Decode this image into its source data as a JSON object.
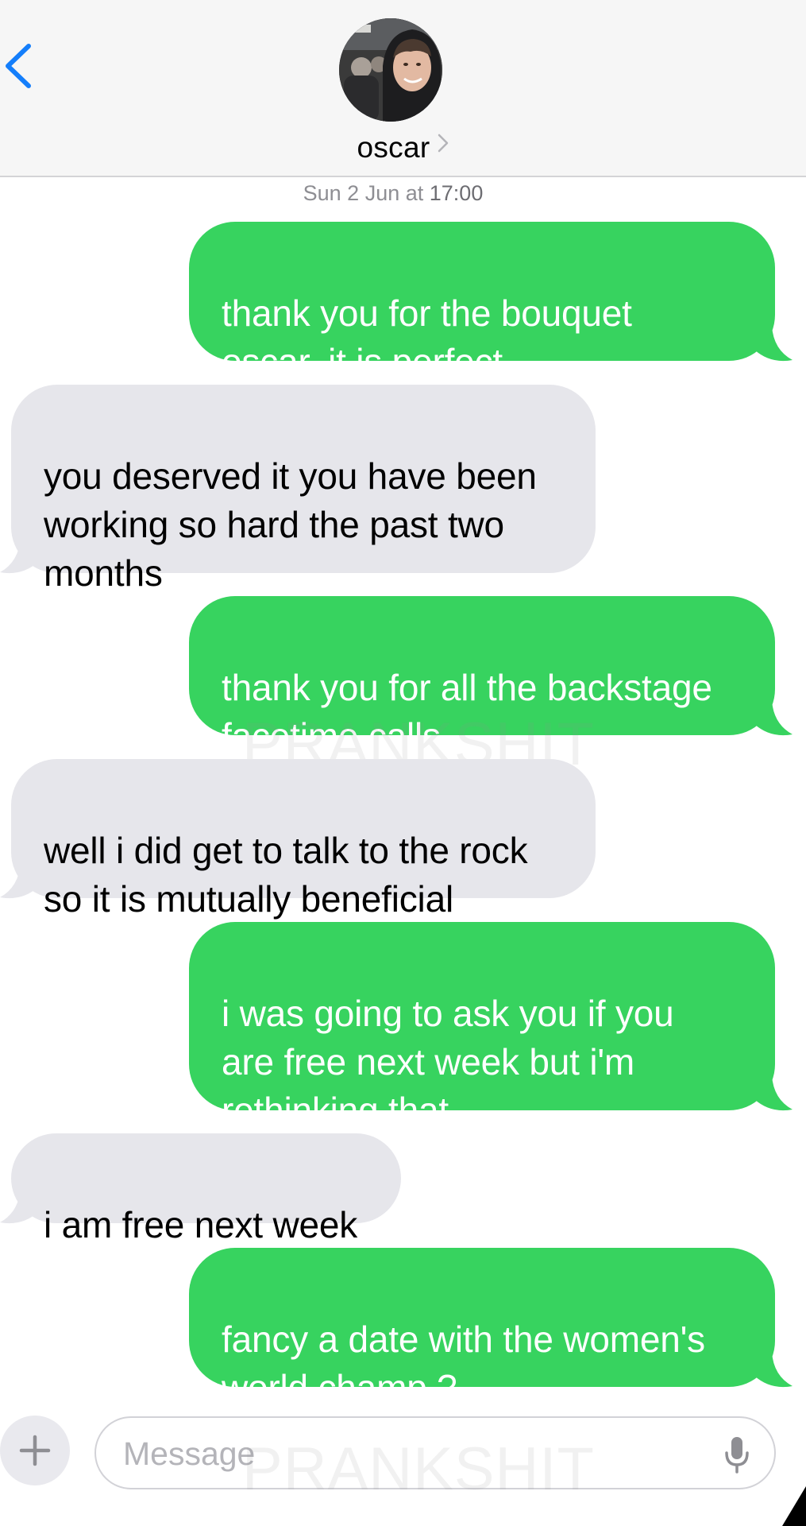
{
  "header": {
    "contact_name": "oscar",
    "back_icon": "chevron-left-icon",
    "details_icon": "chevron-right-icon"
  },
  "thread": {
    "timestamp_day": "Sun 2 Jun at ",
    "timestamp_time": "17:00"
  },
  "messages": [
    {
      "direction": "sent",
      "text": "thank you for the bouquet\noscar, it is perfect"
    },
    {
      "direction": "received",
      "text": "you deserved it you have been\nworking so hard the past two\nmonths"
    },
    {
      "direction": "sent",
      "text": "thank you for all the backstage\nfacetime calls"
    },
    {
      "direction": "received",
      "text": "well i did get to talk to the rock\nso it is mutually beneficial"
    },
    {
      "direction": "sent",
      "text": "i was going to ask you if you\nare free next week but i'm\nrethinking that"
    },
    {
      "direction": "received",
      "text": "i am free next week"
    },
    {
      "direction": "sent",
      "text": "fancy a date with the women's\nworld champ ?"
    }
  ],
  "watermark": "PRANKSHIT",
  "composer": {
    "placeholder": "Message",
    "plus_icon": "plus-icon",
    "mic_icon": "microphone-icon"
  },
  "colors": {
    "sent_bubble": "#37d35f",
    "received_bubble": "#e6e6eb",
    "accent": "#147efb",
    "header_bg": "#f6f6f6"
  }
}
